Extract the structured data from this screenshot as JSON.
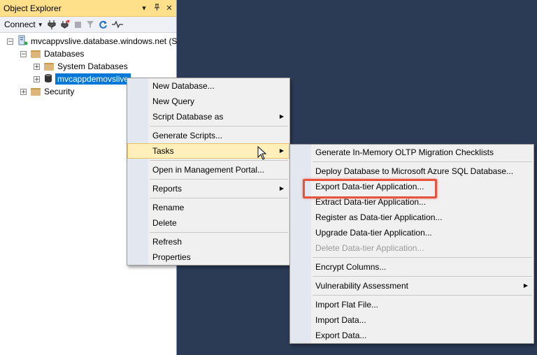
{
  "object_explorer": {
    "title": "Object Explorer",
    "title_buttons": [
      "▾",
      "⊓",
      "✕"
    ],
    "toolbar": {
      "connect_label": "Connect",
      "icons": [
        "connect-plug-icon",
        "disconnect-plug-icon",
        "stop-icon",
        "filter-icon",
        "refresh-icon",
        "activity-monitor-icon"
      ]
    },
    "tree": {
      "server": "mvcappvslive.database.windows.net (S",
      "databases": "Databases",
      "system_databases": "System Databases",
      "selected_db": "mvcappdemovslive",
      "security": "Security"
    }
  },
  "context_menu": {
    "items": [
      "New Database...",
      "New Query",
      "Script Database as",
      "Generate Scripts...",
      "Tasks",
      "Open in Management Portal...",
      "Reports",
      "Rename",
      "Delete",
      "Refresh",
      "Properties"
    ]
  },
  "tasks_submenu": {
    "items": [
      "Generate In-Memory OLTP Migration Checklists",
      "Deploy Database to Microsoft Azure SQL Database...",
      "Export Data-tier Application...",
      "Extract Data-tier Application...",
      "Register as Data-tier Application...",
      "Upgrade Data-tier Application...",
      "Delete Data-tier Application...",
      "Encrypt Columns...",
      "Vulnerability Assessment",
      "Import Flat File...",
      "Import Data...",
      "Export Data..."
    ]
  },
  "colors": {
    "background": "#2b3a55",
    "title_bar": "#ffe08a",
    "selection": "#0078d7",
    "menu_hover": "#ffefbb",
    "highlight_box": "#e8533d"
  }
}
